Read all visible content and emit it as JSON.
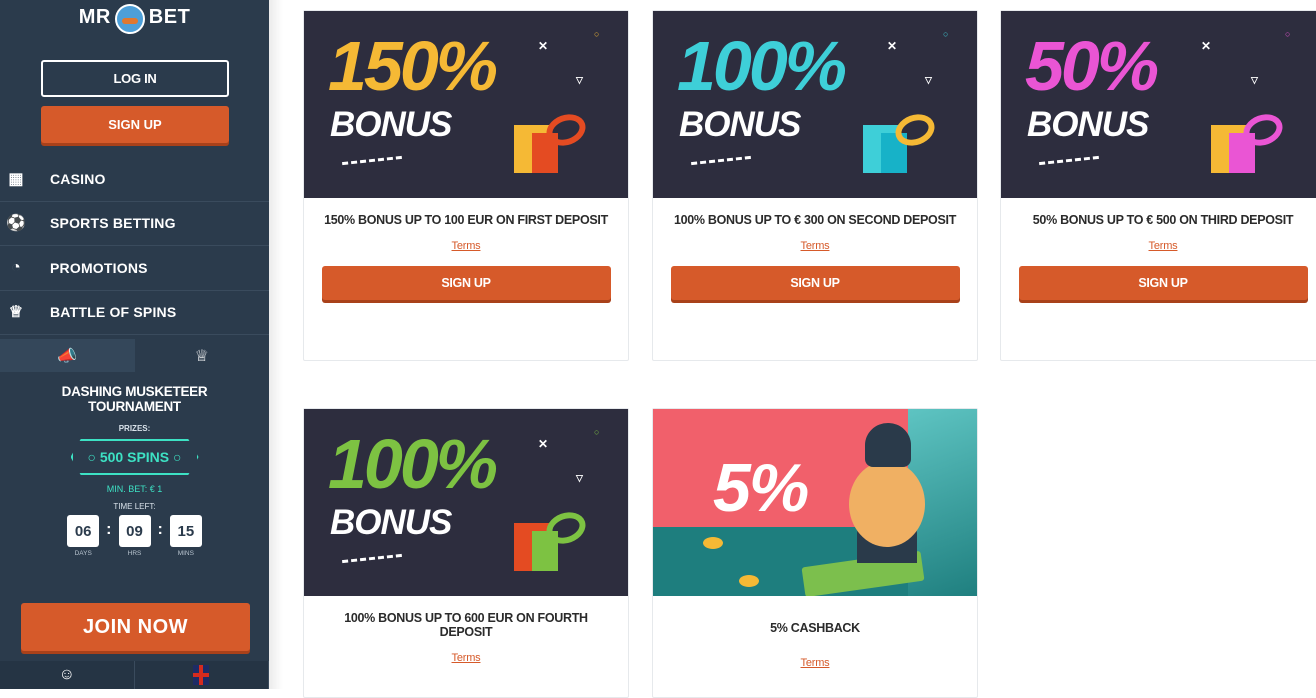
{
  "sidebar": {
    "logo_left": "MR",
    "logo_right": "BET",
    "login_label": "LOG IN",
    "signup_label": "SIGN UP",
    "nav": [
      {
        "label": "CASINO",
        "icon": "slot-machine-icon"
      },
      {
        "label": "SPORTS BETTING",
        "icon": "football-icon"
      },
      {
        "label": "PROMOTIONS",
        "icon": "promo-icon"
      },
      {
        "label": "BATTLE OF SPINS",
        "icon": "trophy-icon"
      }
    ],
    "tournament": {
      "title_line1": "DASHING MUSKETEER",
      "title_line2": "TOURNAMENT",
      "prizes_label": "PRIZES:",
      "prize": "500 SPINS",
      "min_bet": "MIN. BET: € 1",
      "time_left_label": "TIME LEFT:",
      "timer": [
        {
          "value": "06",
          "unit": "DAYS"
        },
        {
          "value": "09",
          "unit": "HRS"
        },
        {
          "value": "15",
          "unit": "MINS"
        }
      ]
    },
    "join_label": "JOIN NOW"
  },
  "cards": [
    {
      "pct": "150%",
      "bonus": "BONUS",
      "title": "150% BONUS UP TO 100 EUR ON FIRST DEPOSIT",
      "terms": "Terms",
      "button": "SIGN UP",
      "color": "#f5b935",
      "ribbon": "#e44b22",
      "box2": "#e44b22"
    },
    {
      "pct": "100%",
      "bonus": "BONUS",
      "title": "100% BONUS UP TO € 300 ON SECOND DEPOSIT",
      "terms": "Terms",
      "button": "SIGN UP",
      "color": "#3ecfd8",
      "ribbon": "#f5b935",
      "box2": "#17b2c8"
    },
    {
      "pct": "50%",
      "bonus": "BONUS",
      "title": "50% BONUS UP TO € 500 ON THIRD DEPOSIT",
      "terms": "Terms",
      "button": "SIGN UP",
      "color": "#ea55d4",
      "ribbon": "#ea55d4",
      "box2": "#ea55d4"
    },
    {
      "pct": "100%",
      "bonus": "BONUS",
      "title": "100% BONUS UP TO 600 EUR ON FOURTH DEPOSIT",
      "terms": "Terms",
      "color": "#7dc242",
      "ribbon": "#7dc242",
      "box2": "#e44b22"
    },
    {
      "pct": "5%",
      "title": "5% CASHBACK",
      "terms": "Terms"
    }
  ]
}
